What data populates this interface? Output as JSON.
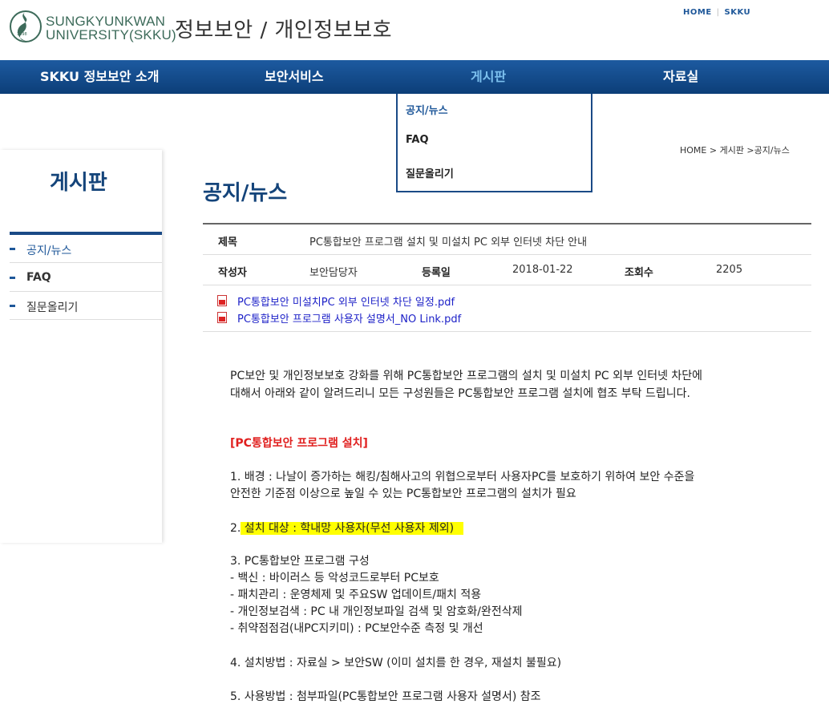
{
  "header": {
    "logo_line1": "SUNGKYUNKWAN",
    "logo_line2": "UNIVERSITY(SKKU)",
    "site_title": "정보보안 / 개인정보보호",
    "util_links": [
      "HOME",
      "SKKU"
    ]
  },
  "nav": {
    "items": [
      "SKKU 정보보안 소개",
      "보안서비스",
      "게시판",
      "자료실"
    ],
    "active": "게시판"
  },
  "dropdown": {
    "items": [
      "공지/뉴스",
      "FAQ",
      "질문올리기"
    ]
  },
  "sidebar": {
    "title": "게시판",
    "items": [
      "공지/뉴스",
      "FAQ",
      "질문올리기"
    ]
  },
  "breadcrumb": "HOME > 게시판 >공지/뉴스",
  "page_title": "공지/뉴스",
  "post": {
    "subject_label": "제목",
    "subject": "PC통합보안 프로그램 설치 및 미설치 PC 외부 인터넷 차단 안내",
    "author_label": "작성자",
    "author": "보안담당자",
    "date_label": "등록일",
    "date": "2018-01-22",
    "views_label": "조회수",
    "views": "2205",
    "attachments": [
      "PC통합보안 미설치PC 외부 인터넷 차단 일정.pdf",
      "PC통합보안 프로그램 사용자 설명서_NO Link.pdf"
    ]
  },
  "content": {
    "intro1": "PC보안 및 개인정보보호 강화를 위해 PC통합보안 프로그램의 설치 및 미설치 PC 외부 인터넷 차단에",
    "intro2": "대해서 아래와 같이 알려드리니 모든 구성원들은 PC통합보안 프로그램 설치에 협조 부탁 드립니다.",
    "heading": "[PC통합보안 프로그램 설치]",
    "item1a": "1. 배경 : 나날이 증가하는 해킹/침해사고의 위협으로부터 사용자PC를 보호하기 위하여 보안 수준을",
    "item1b": "안전한 기준점 이상으로 높일 수 있는 PC통합보안 프로그램의 설치가 필요",
    "item2_num": "2.",
    "item2_text": " 설치 대상 : 학내망 사용자(무선 사용자 제외)",
    "item3": "3. PC통합보안 프로그램 구성",
    "item3a": "- 백신 : 바이러스 등 악성코드로부터 PC보호",
    "item3b": "- 패치관리 : 운영체제 및 주요SW 업데이트/패치 적용",
    "item3c": "- 개인정보검색 : PC 내 개인정보파일 검색 및 암호화/완전삭제",
    "item3d": "- 취약점점검(내PC지키미) : PC보안수준 측정 및 개선",
    "item4": "4. 설치방법 : 자료실 > 보안SW (이미 설치를 한 경우, 재설치 불필요)",
    "item5": "5. 사용방법 : 첨부파일(PC통합보안 프로그램 사용자 설명서) 참조"
  },
  "colors": {
    "nav_bg": "#0c3e78",
    "accent": "#14447a",
    "nav_active": "#7cc0ee",
    "heading_red": "#e0201f",
    "highlight": "#ffff00",
    "link": "#1e22c8"
  }
}
